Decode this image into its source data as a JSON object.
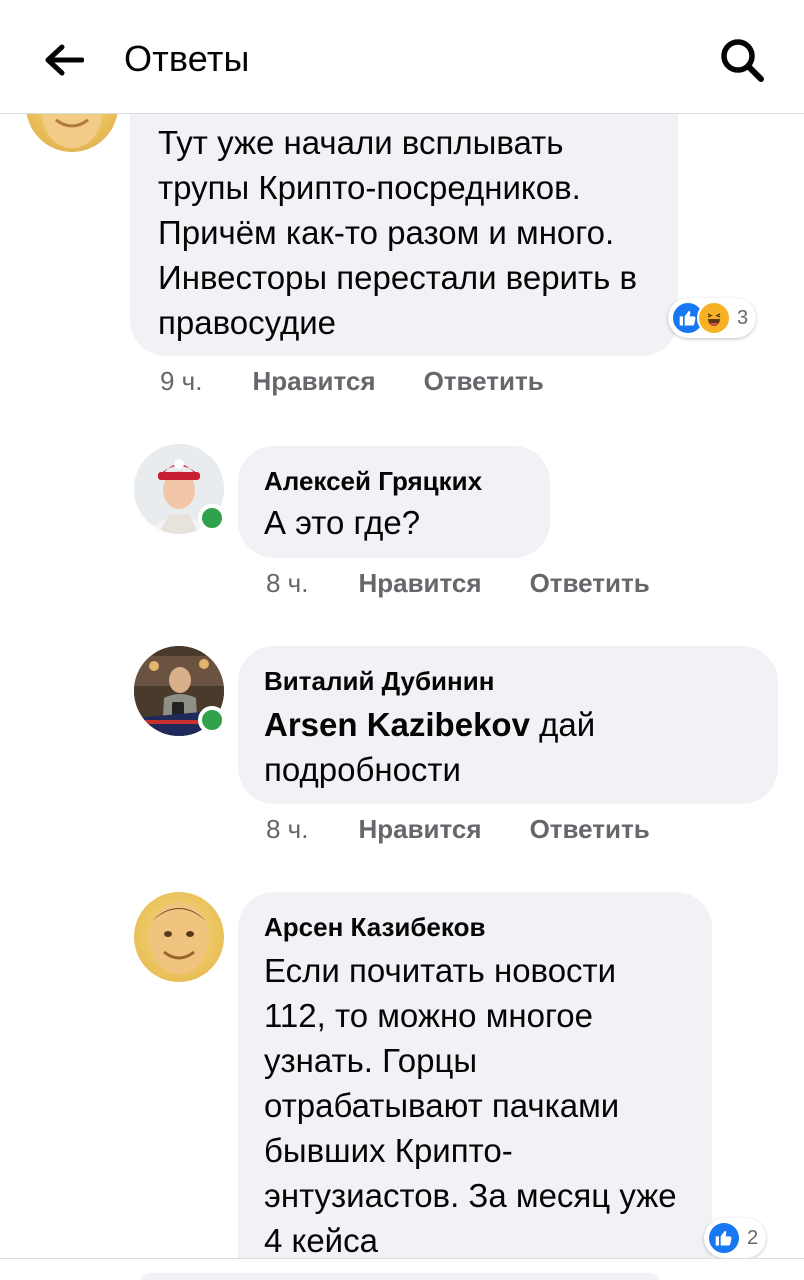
{
  "header": {
    "title": "Ответы"
  },
  "comments": [
    {
      "name": "",
      "text": "Тут уже начали всплывать трупы Крипто-посредников. Причём как-то разом и много. Инвесторы перестали верить в правосудие",
      "time": "9 ч.",
      "like_label": "Нравится",
      "reply_label": "Ответить",
      "reaction_count": "3",
      "reactions": [
        "like-icon",
        "haha-icon"
      ],
      "online": false
    },
    {
      "name": "Алексей Гряцких",
      "text": "А это где?",
      "time": "8 ч.",
      "like_label": "Нравится",
      "reply_label": "Ответить",
      "online": true
    },
    {
      "name": "Виталий Дубинин",
      "mention": "Arsen Kazibekov",
      "text": "дай подробности",
      "time": "8 ч.",
      "like_label": "Нравится",
      "reply_label": "Ответить",
      "online": true
    },
    {
      "name": "Арсен Казибеков",
      "text": "Если почитать новости 112, то можно многое узнать. Горцы отрабатывают пачками бывших Крипто-энтузиастов. За месяц уже 4 кейса",
      "reaction_count": "2",
      "reactions": [
        "like-icon"
      ],
      "online": false
    }
  ],
  "colors": {
    "accent": "#1877f2",
    "bubble": "#f0f2f5",
    "meta": "#65676b",
    "online": "#31a24c"
  }
}
